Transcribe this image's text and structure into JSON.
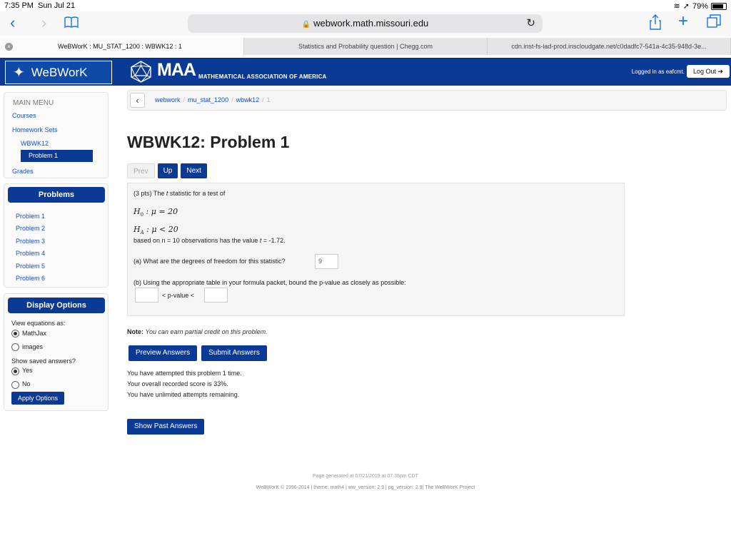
{
  "status_bar": {
    "time": "7:35 PM",
    "date": "Sun Jul 21",
    "battery": "79%"
  },
  "browser": {
    "url": "webwork.math.missouri.edu",
    "tabs": [
      {
        "title": "WeBWorK : MU_STAT_1200 : WBWK12 : 1",
        "active": true
      },
      {
        "title": "Statistics and Probability question | Chegg.com",
        "active": false
      },
      {
        "title": "cdn.inst-fs-iad-prod.inscloudgate.net/c0dadfc7-541a-4c35-948d-3e...",
        "active": false
      }
    ]
  },
  "header": {
    "logo_text": "WeBWorK",
    "maa_abbr": "MAA",
    "maa_full": "MATHEMATICAL ASSOCIATION OF AMERICA",
    "logged_in": "Logged in as eafcmt.",
    "logout": "Log Out"
  },
  "main_menu": {
    "title": "MAIN MENU",
    "courses": "Courses",
    "homework_sets": "Homework Sets",
    "set": "WBWK12",
    "problem": "Problem 1",
    "grades": "Grades"
  },
  "problems": {
    "heading": "Problems",
    "items": [
      "Problem 1",
      "Problem 2",
      "Problem 3",
      "Problem 4",
      "Problem 5",
      "Problem 6"
    ]
  },
  "display_options": {
    "heading": "Display Options",
    "view_label": "View equations as:",
    "mathjax": "MathJax",
    "images": "images",
    "saved_label": "Show saved answers?",
    "yes": "Yes",
    "no": "No",
    "apply": "Apply Options"
  },
  "breadcrumb": {
    "items": [
      "webwork",
      "mu_stat_1200",
      "wbwk12"
    ],
    "current": "1"
  },
  "page_title": "WBWK12: Problem 1",
  "nav": {
    "prev": "Prev",
    "up": "Up",
    "next": "Next"
  },
  "problem": {
    "intro_pre": "(3 pts) The ",
    "intro_var": "t",
    "intro_post": " statistic for a test of",
    "h0": "H",
    "h0_sub": "0",
    "h0_rel": " : μ = 20",
    "ha": "H",
    "ha_sub": "A",
    "ha_rel": " : μ < 20",
    "based_pre": "based on n = 10 observations has the value ",
    "based_var": "t",
    "based_post": " = -1.72.",
    "part_a": "(a) What are the degrees of freedom for this statistic?",
    "part_a_value": "9",
    "part_b": "(b) Using the appropriate table in your formula packet, bound the p-value as closely as possible:",
    "part_b_lower": "",
    "part_b_mid": "< p-value <",
    "part_b_upper": ""
  },
  "note": {
    "label": "Note:",
    "text": "You can earn partial credit on this problem."
  },
  "buttons": {
    "preview": "Preview Answers",
    "submit": "Submit Answers",
    "show_past": "Show Past Answers"
  },
  "attempts": [
    "You have attempted this problem 1 time.",
    "Your overall recorded score is 33%.",
    "You have unlimited attempts remaining."
  ],
  "footer": {
    "generated": "Page generated at 07/21/2019 at 07:35pm CDT",
    "credits": "WeBWorK © 1996-2014 | theme: math4 | ww_version: 2.9 | pg_version: 2.9| The WeBWorK Project"
  }
}
